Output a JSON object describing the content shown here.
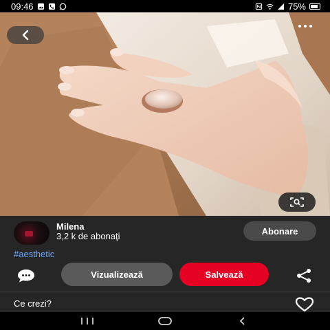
{
  "status_bar": {
    "time": "09:46",
    "battery": "75%",
    "left_icons": [
      "gallery-icon",
      "phone-icon",
      "whatsapp-icon"
    ],
    "right_icons": [
      "nfc-icon",
      "wifi-icon",
      "signal-icon",
      "battery-icon"
    ]
  },
  "pin": {
    "image_description_icons": [
      "back-arrow-icon",
      "more-options-icon",
      "visual-search-icon"
    ]
  },
  "creator": {
    "name": "Milena",
    "followers": "3,2 k de abonaţi",
    "subscribe_label": "Abonare"
  },
  "hashtag": "#aesthetic",
  "actions": {
    "view_label": "Vizualizează",
    "save_label": "Salvează"
  },
  "comment_prompt": "Ce crezi?",
  "colors": {
    "accent_save": "#e60023",
    "hashtag": "#6aa6ff",
    "panel": "#262626"
  }
}
